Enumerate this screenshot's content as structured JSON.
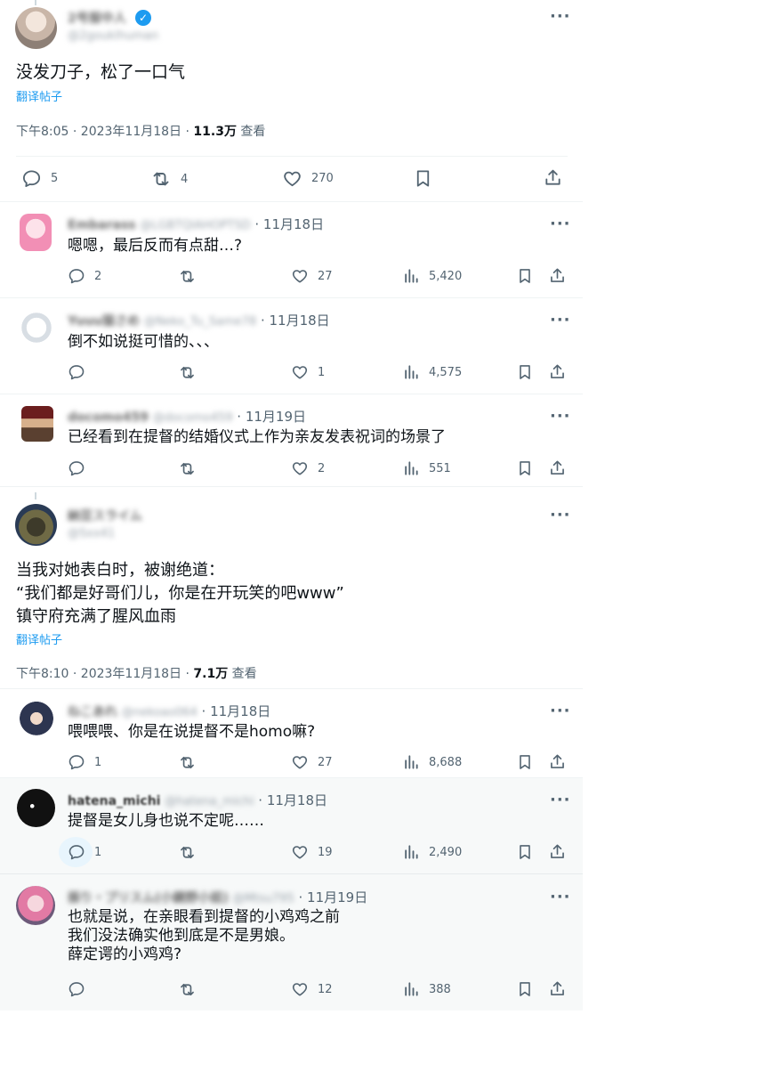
{
  "main1": {
    "name": "2号服中人",
    "handle": "@2gouklhuman",
    "text": "没发刀子，松了一口气",
    "translate": "翻译帖子",
    "time": "下午8:05 · 2023年11月18日 · ",
    "views": "11.3万",
    "views_label": " 查看",
    "replies": "5",
    "retweets": "4",
    "likes": "270"
  },
  "main2": {
    "name": "納豆スライム",
    "handle": "@Sxx41",
    "text_lines": [
      "当我对她表白时，被谢绝道：",
      "“我们都是好哥们儿，你是在开玩笑的吧www”",
      "镇守府充满了腥风血雨"
    ],
    "translate": "翻译帖子",
    "time": "下午8:10 · 2023年11月18日 · ",
    "views": "7.1万",
    "views_label": " 查看"
  },
  "replies": [
    {
      "name": "Embarass",
      "handle": "@LGBTQIAHOPTSD",
      "date": " · 11月18日",
      "lines": [
        "嗯嗯，最后反而有点甜…?"
      ],
      "reply": "2",
      "rt": "",
      "like": "27",
      "views": "5,420"
    },
    {
      "name": "Yuuu猫さめ",
      "handle": "@Neko_Tu_Same78",
      "date": " · 11月18日",
      "lines": [
        "倒不如说挺可惜的、、、"
      ],
      "reply": "",
      "rt": "",
      "like": "1",
      "views": "4,575"
    },
    {
      "name": "docomo459",
      "handle": "@docomo459",
      "date": " · 11月19日",
      "lines": [
        "已经看到在提督的结婚仪式上作为亲友发表祝词的场景了"
      ],
      "reply": "",
      "rt": "",
      "like": "2",
      "views": "551"
    },
    {
      "name": "ねこあれ",
      "handle": "@nekoao064",
      "date": " · 11月18日",
      "lines": [
        "喂喂喂、你是在说提督不是homo嘛?"
      ],
      "reply": "1",
      "rt": "",
      "like": "27",
      "views": "8,688"
    },
    {
      "name": "hatena_michi",
      "handle": "@hatena_michi",
      "date": " · 11月18日",
      "lines": [
        "提督是女儿身也说不定呢……"
      ],
      "reply": "1",
      "rt": "",
      "like": "19",
      "views": "2,490"
    },
    {
      "name": "振り・プリスム(小鏡野小姐)",
      "handle": "@Mtsu795",
      "date": " · 11月19日",
      "lines": [
        "也就是说，在亲眼看到提督的小鸡鸡之前",
        "我们没法确实他到底是不是男娘。",
        "薛定谔的小鸡鸡?"
      ],
      "reply": "",
      "rt": "",
      "like": "12",
      "views": "388"
    }
  ],
  "icons": [
    "reply-icon",
    "retweet-icon",
    "like-icon",
    "views-icon",
    "bookmark-icon",
    "share-icon",
    "more-icon",
    "verified-icon"
  ],
  "colors": {
    "accent": "#1d9bf0",
    "text": "#0f1419",
    "muted": "#536471",
    "divider": "#eff3f4",
    "highlight_bg": "#f7f9f9"
  }
}
